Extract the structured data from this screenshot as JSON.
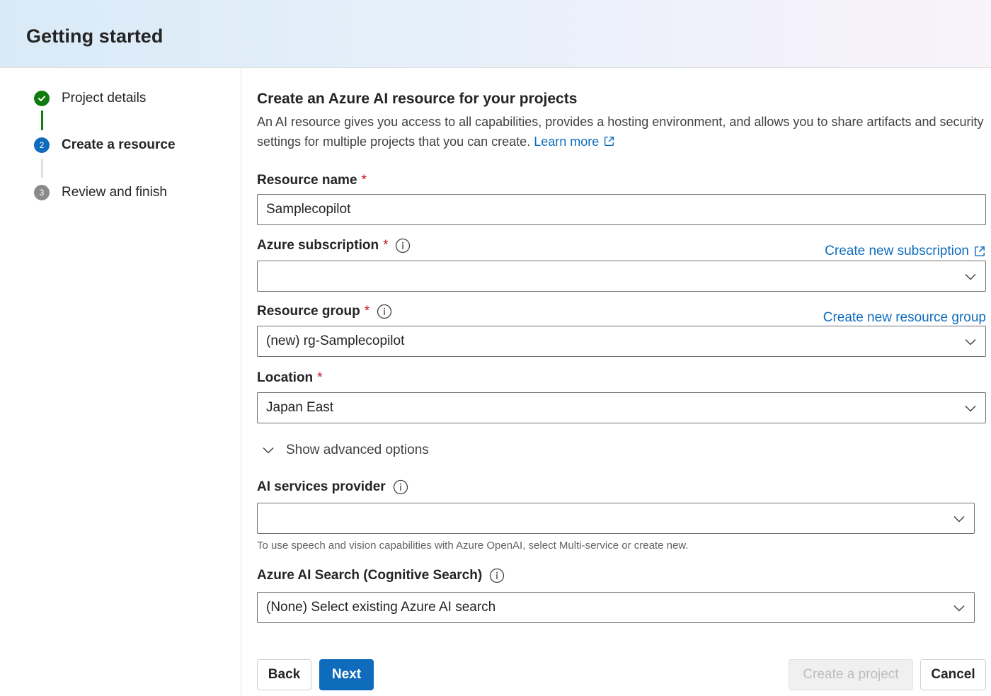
{
  "header": {
    "title": "Getting started"
  },
  "steps": [
    {
      "label": "Project details",
      "status": "done",
      "number": ""
    },
    {
      "label": "Create a resource",
      "status": "active",
      "number": "2"
    },
    {
      "label": "Review and finish",
      "status": "pending",
      "number": "3"
    }
  ],
  "section": {
    "title": "Create an Azure AI resource for your projects",
    "description": "An AI resource gives you access to all capabilities, provides a hosting environment, and allows you to share artifacts and security settings for multiple projects that you can create.",
    "learn_more": "Learn more"
  },
  "fields": {
    "resource_name": {
      "label": "Resource name",
      "required_mark": "*",
      "value": "Samplecopilot"
    },
    "subscription": {
      "label": "Azure subscription",
      "required_mark": "*",
      "value": "",
      "create_link": "Create new subscription"
    },
    "resource_group": {
      "label": "Resource group",
      "required_mark": "*",
      "value": "(new) rg-Samplecopilot",
      "create_link": "Create new resource group"
    },
    "location": {
      "label": "Location",
      "required_mark": "*",
      "value": "Japan East"
    },
    "ai_services": {
      "label": "AI services provider",
      "value": "",
      "hint": "To use speech and vision capabilities with Azure OpenAI, select Multi-service or create new."
    },
    "ai_search": {
      "label": "Azure AI Search (Cognitive Search)",
      "value": "(None) Select existing Azure AI search"
    }
  },
  "advanced": {
    "label": "Show advanced options"
  },
  "buttons": {
    "back": "Back",
    "next": "Next",
    "create_project": "Create a project",
    "cancel": "Cancel"
  },
  "colors": {
    "accent": "#0f6cbd",
    "success": "#107c10",
    "required": "#c50f1f"
  }
}
